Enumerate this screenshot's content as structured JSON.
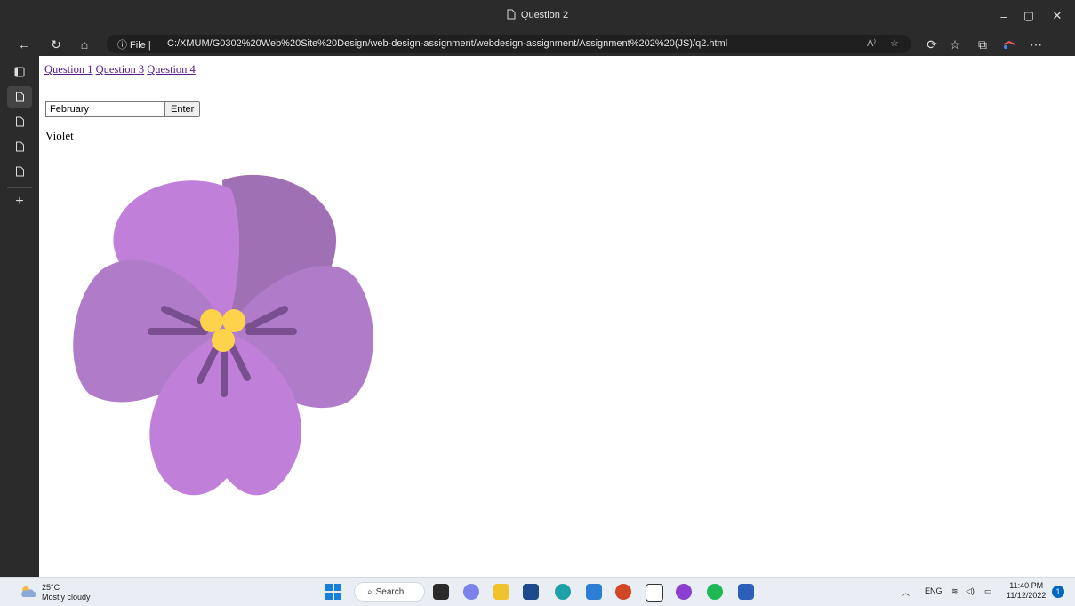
{
  "window": {
    "title": "Question 2",
    "minimize": "–",
    "restore": "▢",
    "close": "✕"
  },
  "toolbar": {
    "info": "ⓘ File |",
    "url": "C:/XMUM/G0302%20Web%20Site%20Design/web-design-assignment/webdesign-assignment/Assignment%202%20(JS)/q2.html",
    "read_aloud": "A⁾",
    "favorites_star": "☆"
  },
  "page": {
    "nav_links": [
      "Question 1",
      "Question 3",
      "Question 4"
    ],
    "input": {
      "value": "February"
    },
    "enter_button": "Enter",
    "result": "Violet"
  },
  "taskbar": {
    "weather_temp": "25°C",
    "weather_desc": "Mostly cloudy",
    "search_label": "Search",
    "language": "ENG",
    "time": "11:40 PM",
    "date": "11/12/2022",
    "notification_count": "1"
  },
  "colors": {
    "petal_light": "#c07fd9",
    "petal_mid": "#b07bc9",
    "petal_dark": "#a070b5",
    "stamen": "#7a4f8f",
    "center": "#fcd34a"
  }
}
